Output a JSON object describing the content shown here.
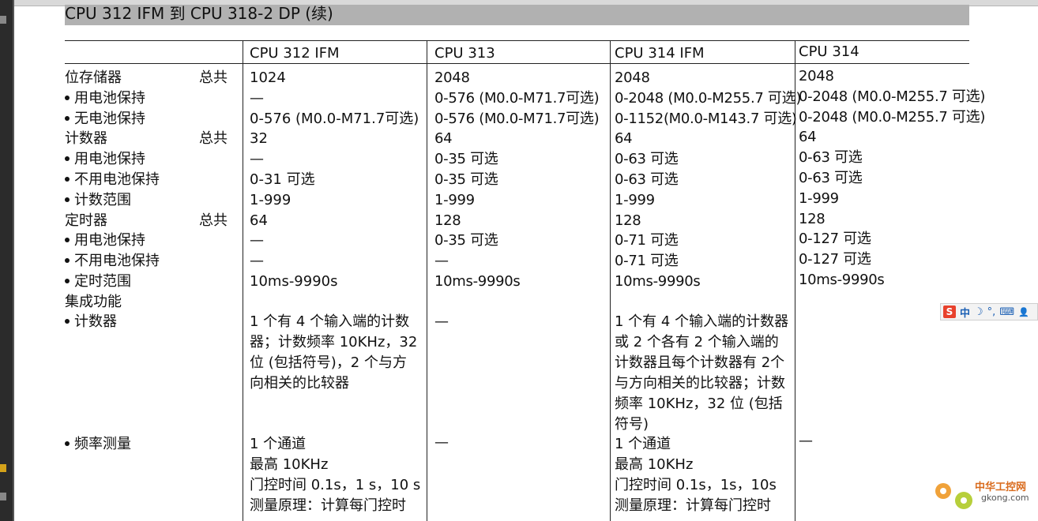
{
  "header": {
    "title": "CPU 312 IFM 到 CPU 318-2 DP (续)"
  },
  "columns": [
    "CPU 312 IFM",
    "CPU 313",
    "CPU 314 IFM",
    "CPU 314"
  ],
  "rows": [
    {
      "label": "位存储器",
      "total": "总共",
      "bullet": false,
      "values": [
        "1024",
        "2048",
        "2048",
        "2048"
      ]
    },
    {
      "label": "用电池保持",
      "total": "",
      "bullet": true,
      "values": [
        "—",
        "0-576 (M0.0-M71.7可选)",
        "0-2048 (M0.0-M255.7 可选)",
        "0-2048 (M0.0-M255.7 可选)"
      ]
    },
    {
      "label": "无电池保持",
      "total": "",
      "bullet": true,
      "values": [
        "0-576 (M0.0-M71.7可选)",
        "0-576 (M0.0-M71.7可选)",
        "0-1152(M0.0-M143.7 可选)",
        "0-2048 (M0.0-M255.7 可选)"
      ]
    },
    {
      "label": "计数器",
      "total": "总共",
      "bullet": false,
      "values": [
        "32",
        "64",
        "64",
        "64"
      ]
    },
    {
      "label": "用电池保持",
      "total": "",
      "bullet": true,
      "values": [
        "—",
        "0-35 可选",
        "0-63 可选",
        "0-63 可选"
      ]
    },
    {
      "label": "不用电池保持",
      "total": "",
      "bullet": true,
      "values": [
        "0-31 可选",
        "0-35 可选",
        "0-63 可选",
        "0-63 可选"
      ]
    },
    {
      "label": "计数范围",
      "total": "",
      "bullet": true,
      "values": [
        "1-999",
        "1-999",
        "1-999",
        "1-999"
      ]
    },
    {
      "label": "定时器",
      "total": "总共",
      "bullet": false,
      "values": [
        "64",
        "128",
        "128",
        "128"
      ]
    },
    {
      "label": "用电池保持",
      "total": "",
      "bullet": true,
      "values": [
        "—",
        "0-35 可选",
        "0-71 可选",
        "0-127 可选"
      ]
    },
    {
      "label": "不用电池保持",
      "total": "",
      "bullet": true,
      "values": [
        "—",
        "—",
        "0-71 可选",
        "0-127 可选"
      ]
    },
    {
      "label": "定时范围",
      "total": "",
      "bullet": true,
      "values": [
        "10ms-9990s",
        "10ms-9990s",
        "10ms-9990s",
        "10ms-9990s"
      ]
    },
    {
      "label": "集成功能",
      "total": "",
      "bullet": false,
      "values": [
        "",
        "",
        "",
        ""
      ]
    }
  ],
  "counter_row": {
    "label": "计数器",
    "c1": "1 个有 4 个输入端的计数器；计数频率 10KHz，32 位 (包括符号)，2 个与方向相关的比较器",
    "c2": "—",
    "c3": "1 个有 4 个输入端的计数器或 2 个各有 2 个输入端的计数器且每个计数器有 2个与方向相关的比较器；计数频率 10KHz，32 位 (包括符号)",
    "c4": ""
  },
  "freq_row": {
    "label": "频率测量",
    "c1": [
      "1 个通道",
      "最高 10KHz",
      "门控时间 0.1s，1 s，10 s",
      "测量原理：计算每门控时"
    ],
    "c2": "—",
    "c3": [
      "1 个通道",
      "最高 10KHz",
      "门控时间 0.1s，1s，10s",
      "测量原理：计算每门控时"
    ],
    "c4": "—"
  },
  "ime": {
    "logo": "S",
    "lang": "中",
    "moon": "☽",
    "punct": "°,",
    "kbd": "⌨",
    "user": "👤"
  },
  "watermark": {
    "text": "中华工控网",
    "url": "gkong.com"
  },
  "colors": {
    "header_band": "#b1b1b1",
    "left_bar": "#2b2b2b",
    "watermark_orange": "#d96b1d"
  }
}
